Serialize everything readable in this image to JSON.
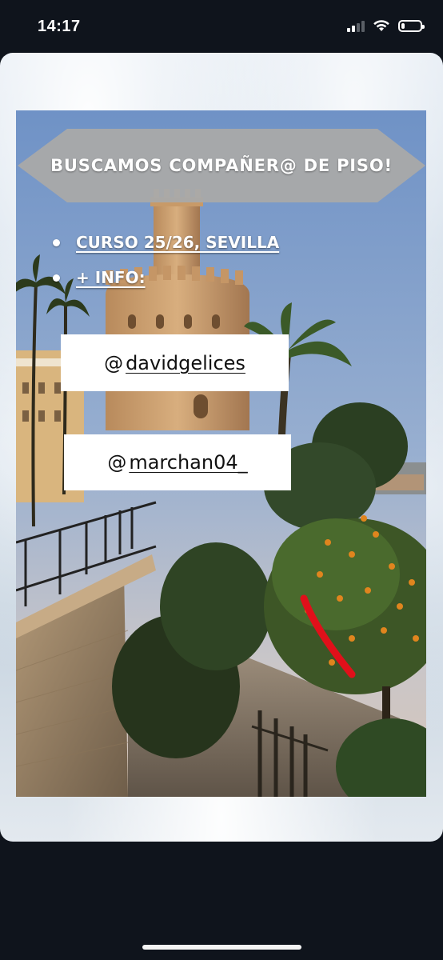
{
  "status_bar": {
    "time": "14:17",
    "signal_bars_active": 2,
    "signal_bars_total": 4,
    "battery_level": 0.18
  },
  "post": {
    "title": "BUSCAMOS COMPAÑER@ DE PISO!",
    "bullets": [
      "CURSO 25/26, SEVILLA",
      "+ INFO:"
    ],
    "handles": [
      "davidgelices",
      "marchan04_"
    ],
    "handle_icon": "threads-icon",
    "colors": {
      "banner": "#a9a9a9",
      "text": "#ffffff",
      "annotation_stroke": "#e0101a"
    }
  }
}
